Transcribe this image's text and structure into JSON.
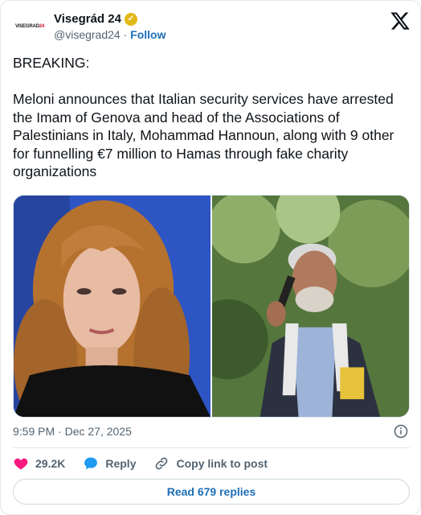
{
  "account": {
    "display_name": "Visegrád 24",
    "handle": "@visegrad24",
    "separator": "·",
    "follow_label": "Follow",
    "avatar_text_main": "VISEGRAD",
    "avatar_text_accent": "24",
    "verified_color": "#e2b719"
  },
  "tweet": {
    "line1": "BREAKING:",
    "line2": "Meloni announces that Italian security services have arrested the Imam of Genova and head of the Associations of Palestinians in Italy, Mohammad Hannoun, along with 9 other for funnelling €7 million to Hamas through fake charity organizations"
  },
  "meta": {
    "timestamp": "9:59 PM · Dec 27, 2025"
  },
  "actions": {
    "like_count": "29.2K",
    "reply_label": "Reply",
    "copy_label": "Copy link to post"
  },
  "footer": {
    "read_replies_label": "Read 679 replies"
  },
  "colors": {
    "like": "#f91880",
    "reply": "#1d9bf0",
    "link": "#1d6fb8",
    "muted": "#536471"
  },
  "icons": [
    "x-logo-icon",
    "verified-badge-icon",
    "heart-icon",
    "reply-bubble-icon",
    "link-icon",
    "info-icon"
  ]
}
